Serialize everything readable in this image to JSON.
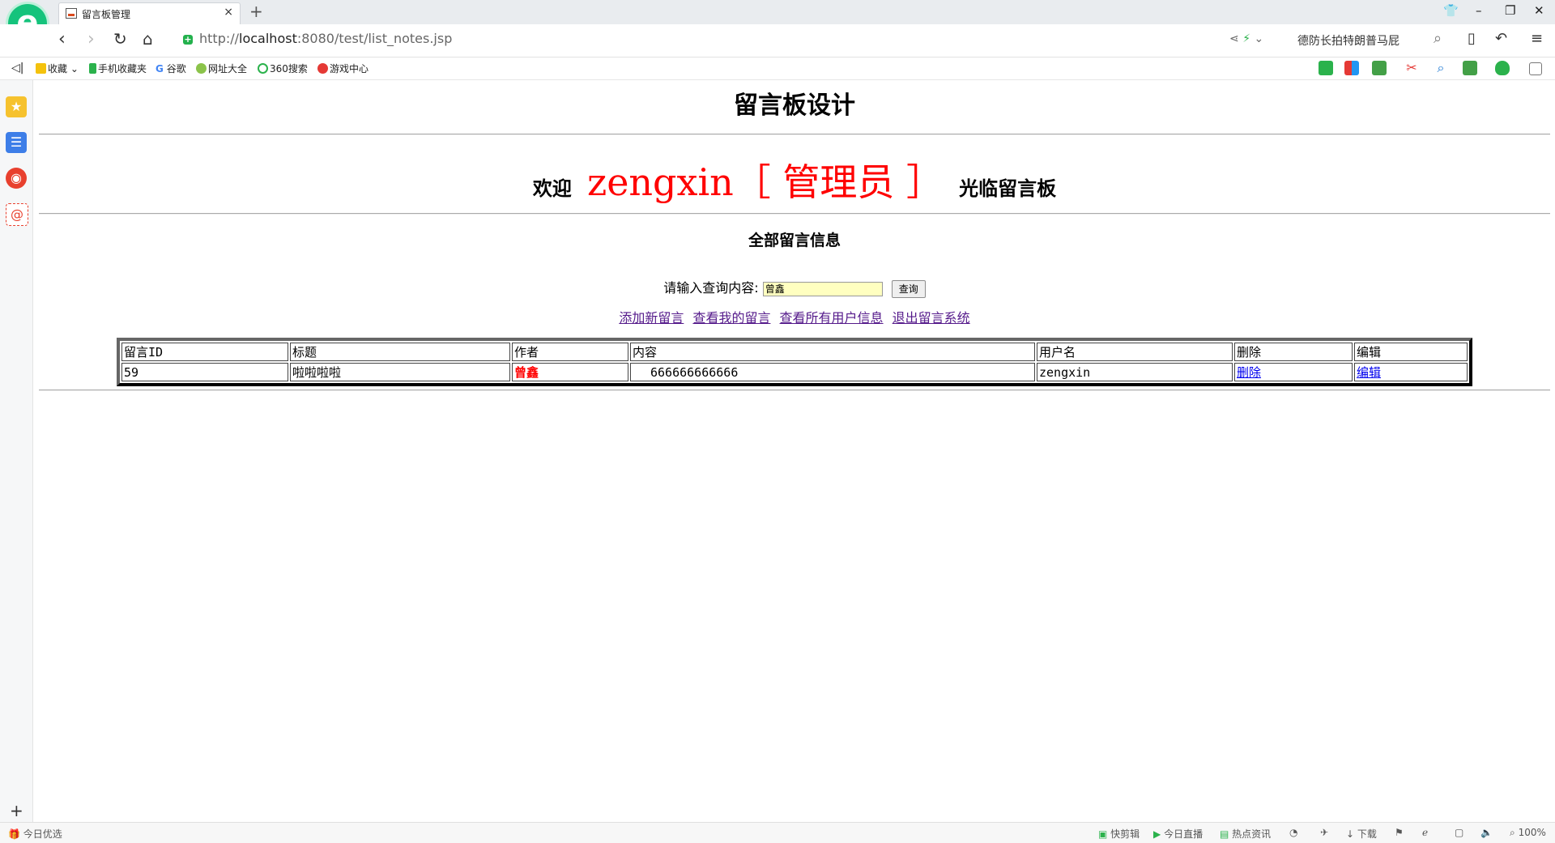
{
  "browser": {
    "tab_title": "留言板管理",
    "tab_close": "×",
    "new_tab": "+",
    "url_scheme_host": "http://",
    "url_host": "localhost",
    "url_rest": ":8080/test/list_notes.jsp",
    "search_suggestion": "德防长拍特朗普马屁",
    "zoom": "100%"
  },
  "bookmarks": [
    {
      "label": "收藏",
      "icon": "star-icon"
    },
    {
      "label": "手机收藏夹",
      "icon": "phone-icon"
    },
    {
      "label": "谷歌",
      "icon": "google-icon"
    },
    {
      "label": "网址大全",
      "icon": "compass-icon"
    },
    {
      "label": "360搜索",
      "icon": "search360-icon"
    },
    {
      "label": "游戏中心",
      "icon": "game-icon"
    }
  ],
  "statusbar": {
    "left": "今日优选",
    "items": [
      "快剪辑",
      "今日直播",
      "热点资讯",
      "下载"
    ]
  },
  "page": {
    "heading": "留言板设计",
    "welcome_prefix": "欢迎",
    "welcome_user": "zengxin［ 管理员 ］",
    "welcome_suffix": "光临留言板",
    "section_title": "全部留言信息",
    "search_label": "请输入查询内容:",
    "search_value": "曾鑫",
    "search_button": "查询",
    "links": [
      "添加新留言",
      "查看我的留言",
      "查看所有用户信息",
      "退出留言系统"
    ]
  },
  "table": {
    "headers": [
      "留言ID",
      "标题",
      "作者",
      "内容",
      "用户名",
      "删除",
      "编辑"
    ],
    "rows": [
      {
        "id": "59",
        "title": "啦啦啦啦",
        "author": "曾鑫",
        "content": "666666666666",
        "username": "zengxin",
        "delete": "删除",
        "edit": "编辑"
      }
    ]
  }
}
